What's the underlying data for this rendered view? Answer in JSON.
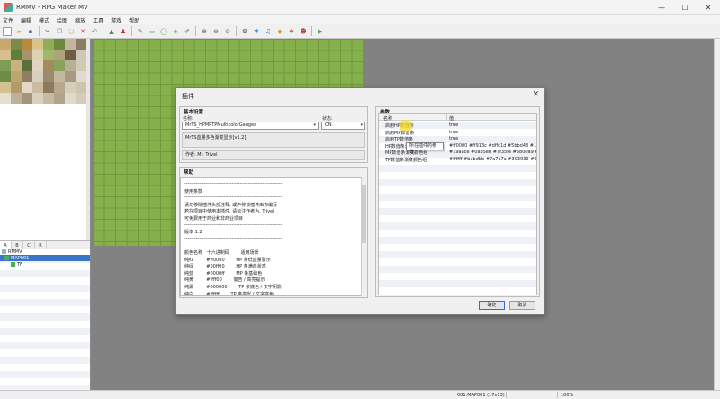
{
  "window": {
    "title": "RMMV - RPG Maker MV",
    "controls": [
      "—",
      "☐",
      "✕"
    ]
  },
  "menubar": [
    "文件",
    "编辑",
    "模式",
    "绘图",
    "缩放",
    "工具",
    "游戏",
    "帮助"
  ],
  "toolbar": {
    "icons": [
      {
        "name": "new-project-icon",
        "glyph": "▫",
        "color": "#ffffff"
      },
      {
        "name": "open-project-icon",
        "glyph": "▰",
        "color": "#e8b54a"
      },
      {
        "name": "save-project-icon",
        "glyph": "▪",
        "color": "#3d6fb6"
      },
      {
        "name": "cut-icon",
        "glyph": "✂",
        "color": "#666666"
      },
      {
        "name": "copy-icon",
        "glyph": "❐",
        "color": "#5a8fd6"
      },
      {
        "name": "paste-icon",
        "glyph": "❏",
        "color": "#d9b26a"
      },
      {
        "name": "delete-icon",
        "glyph": "✕",
        "color": "#cc3333"
      },
      {
        "name": "undo-icon",
        "glyph": "↶",
        "color": "#3a6dbd"
      },
      {
        "name": "map-mode-icon",
        "glyph": "▲",
        "color": "#4f8a3a"
      },
      {
        "name": "event-mode-icon",
        "glyph": "♟",
        "color": "#c0392b"
      },
      {
        "name": "pencil-icon",
        "glyph": "✎",
        "color": "#3a7d3a"
      },
      {
        "name": "rectangle-icon",
        "glyph": "▭",
        "color": "#4caf50"
      },
      {
        "name": "ellipse-icon",
        "glyph": "◯",
        "color": "#4caf50"
      },
      {
        "name": "fill-icon",
        "glyph": "◈",
        "color": "#4caf50"
      },
      {
        "name": "shadow-pen-icon",
        "glyph": "✐",
        "color": "#666666"
      },
      {
        "name": "zoom-in-icon",
        "glyph": "⊕",
        "color": "#555555"
      },
      {
        "name": "zoom-out-icon",
        "glyph": "⊖",
        "color": "#555555"
      },
      {
        "name": "zoom-actual-icon",
        "glyph": "⊙",
        "color": "#555555"
      },
      {
        "name": "database-icon",
        "glyph": "⚙",
        "color": "#444444"
      },
      {
        "name": "plugin-manager-icon",
        "glyph": "✱",
        "color": "#3a8ad6"
      },
      {
        "name": "sound-test-icon",
        "glyph": "♫",
        "color": "#3a8ad6"
      },
      {
        "name": "event-searcher-icon",
        "glyph": "◆",
        "color": "#d6a020"
      },
      {
        "name": "resource-manager-icon",
        "glyph": "❖",
        "color": "#d05050"
      },
      {
        "name": "character-generator-icon",
        "glyph": "☻",
        "color": "#c0392b"
      },
      {
        "name": "playtest-icon",
        "glyph": "▶",
        "color": "#2e9e3e"
      }
    ]
  },
  "palette_colors": [
    "#c9a86b",
    "#7a8c4a",
    "#b98a3e",
    "#d9c48a",
    "#8fae57",
    "#6d8a3c",
    "#c2b59a",
    "#8c7b63",
    "#d7c08e",
    "#5f7e3b",
    "#a7926b",
    "#dcd2b0",
    "#9db86a",
    "#b0a07e",
    "#6f5d43",
    "#cfc7b7",
    "#7e9c55",
    "#c8b27f",
    "#5c6f3a",
    "#e0d6c0",
    "#a58a5c",
    "#87a45a",
    "#b9ae99",
    "#d3cab6",
    "#6c8d49",
    "#bca66e",
    "#8f7e62",
    "#d8cfbe",
    "#9a8b70",
    "#c4b89e",
    "#a89a82",
    "#dedad2",
    "#d2c28f",
    "#b39a6a",
    "#e2d8c4",
    "#c9bca2",
    "#8d7a5d",
    "#b7a88b",
    "#d6cdbb",
    "#cec4ad",
    "#e5dfcf",
    "#bfb09a",
    "#a3947c",
    "#d9d1c0",
    "#c7baa2",
    "#b2a48c",
    "#e0dacb",
    "#d4ccb9"
  ],
  "map_tree": {
    "tabs": [
      "A",
      "B",
      "C",
      "R"
    ],
    "items": [
      {
        "label": "RMMV",
        "icon_color": "#8ab4e8"
      },
      {
        "label": "MAP001",
        "icon_color": "#4caf50"
      },
      {
        "label": "TF",
        "icon_color": "#4caf50"
      }
    ]
  },
  "statusbar": {
    "map_info": "001:MAP001 (17x13)",
    "zoom": "100%"
  },
  "plugin_dialog": {
    "title": "插件",
    "close": "✕",
    "basic_settings_title": "基本设置",
    "name_label": "名称:",
    "name_value": "MrTS_HPMPTPMulticolorGauges",
    "status_label": "状态:",
    "status_value": "ON",
    "description": "MrTS血量多色渐变显示[v1.2]",
    "author": "作者: Mr. Trivel",
    "help_title": "帮助",
    "help_lines": [
      "------------------------------------------------------------",
      "使用条款",
      "------------------------------------------------------------",
      "请勿移除插件头部注释, 或声称该插件由你编写",
      "若在项目中使用本插件, 请标注作者为, Trivel",
      "可免费用于商业和非商业项目",
      "------------------------------------------------------------",
      "版本 1.2",
      "------------------------------------------------------------",
      "",
      "颜色名称   十六进制码        适用场景",
      "纯红         #ff0000        HP 条低血量警示",
      "纯绿         #00ff00        HP 条满血状态",
      "纯蓝         #0000ff        MP 条基础色",
      "纯黄         #ffff00        警告 / 高亮提示",
      "纯黑         #000000        TP 条底色 / 文字阴影",
      "纯白         #ffffff        TP 条高光 / 文字底色"
    ],
    "params_title": "参数",
    "params_headers": {
      "name": "名称",
      "value": "值"
    },
    "params": [
      {
        "name": "启用HP数值条",
        "value": "true"
      },
      {
        "name": "启用MP数值条",
        "value": "true"
      },
      {
        "name": "启用TP数值条",
        "value": "true"
      },
      {
        "name": "HP数值条渐变颜色组",
        "value": "#ff0000 #ff913c #dffc1d #5bbd48 #1···"
      },
      {
        "name": "MP数值条渐变颜色组",
        "value": "#19aace #0ab5eb #7f35fe #5800a9 #0···"
      },
      {
        "name": "TP数值条渐变颜色组",
        "value": "#ffffff #babdbb #7a7a7a #393939 #0···"
      }
    ],
    "tooltip": "所在插件的参数。",
    "ok_label": "确定",
    "cancel_label": "取消"
  }
}
